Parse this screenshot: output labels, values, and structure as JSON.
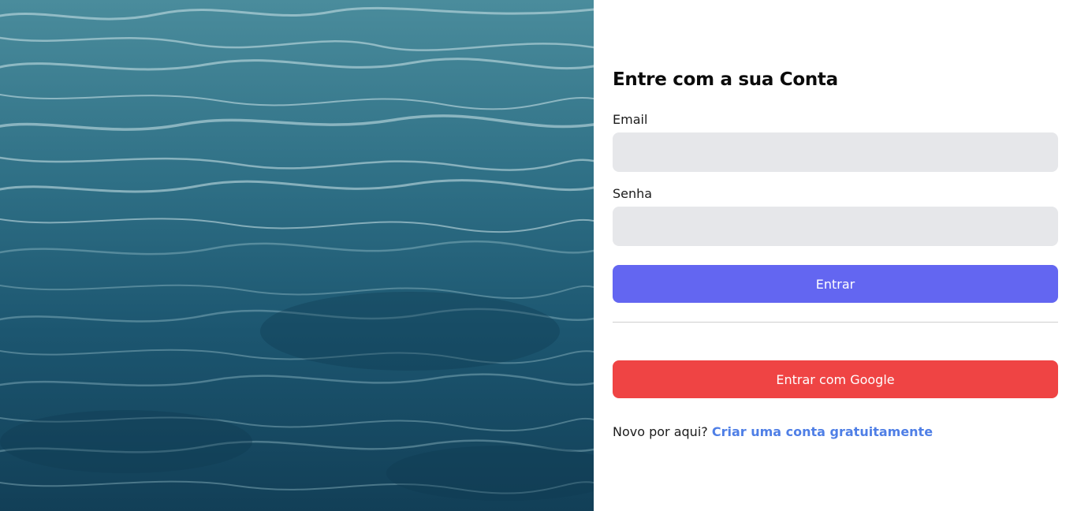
{
  "hero": {
    "image": "ocean-waves-photo"
  },
  "login": {
    "title": "Entre com a sua Conta",
    "email_label": "Email",
    "email_value": "",
    "password_label": "Senha",
    "password_value": "",
    "submit_label": "Entrar",
    "google_label": "Entrar com Google",
    "signup_prompt": "Novo por aqui?",
    "signup_link": "Criar uma conta gratuitamente"
  },
  "colors": {
    "primary": "#6366f1",
    "google": "#ef4444",
    "link": "#4f7fe6",
    "input_bg": "#e6e7ea"
  }
}
